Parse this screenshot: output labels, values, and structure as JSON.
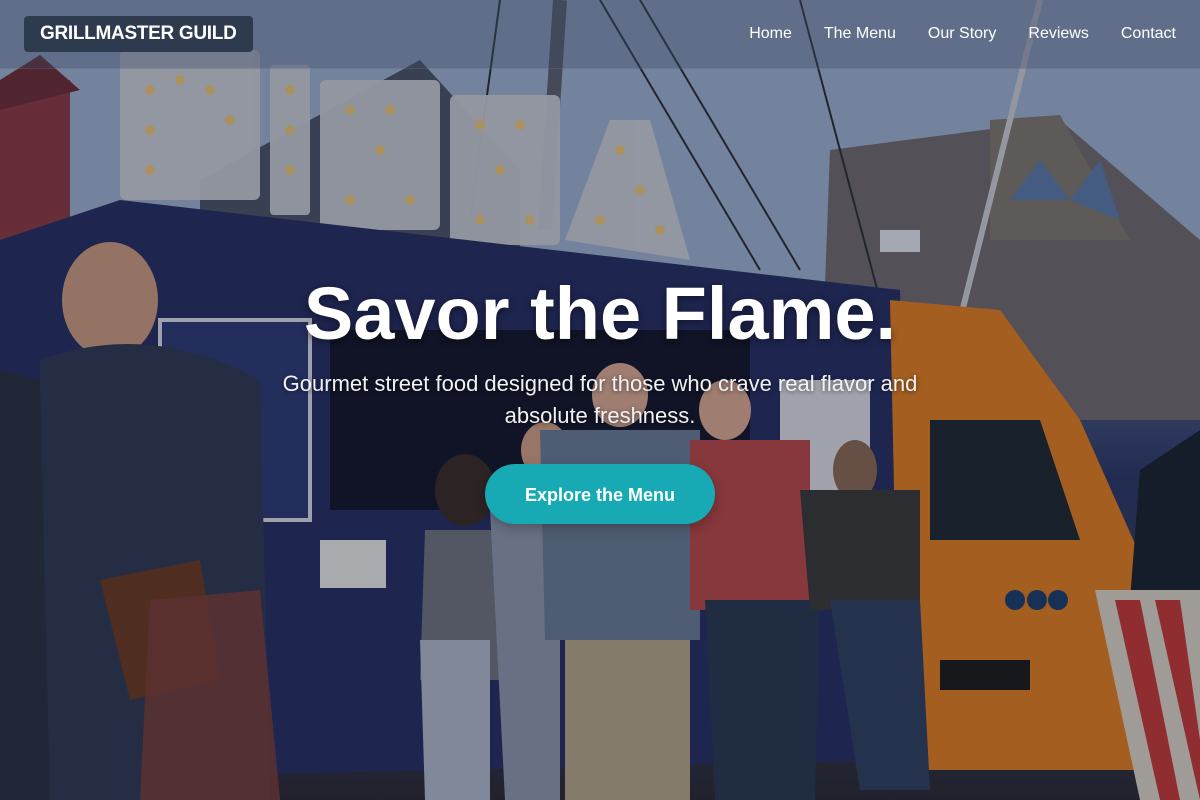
{
  "brand": {
    "logo_text": "GRILLMASTER GUILD"
  },
  "nav": {
    "items": [
      {
        "label": "Home"
      },
      {
        "label": "The Menu"
      },
      {
        "label": "Our Story"
      },
      {
        "label": "Reviews"
      },
      {
        "label": "Contact"
      }
    ]
  },
  "hero": {
    "title": "Savor the Flame.",
    "subtitle": "Gourmet street food designed for those who crave real flavor and absolute freshness.",
    "cta_label": "Explore the Menu",
    "background_image": "food-truck-pizza-sign-crowd-photo"
  },
  "colors": {
    "accent": "#17aab4",
    "logo_bg": "#2e3a4e",
    "text": "#ffffff"
  }
}
